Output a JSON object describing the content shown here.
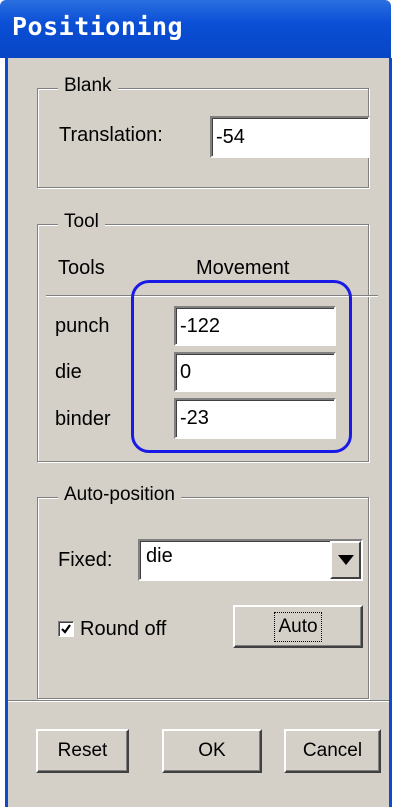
{
  "window": {
    "title": "Positioning"
  },
  "blank": {
    "group_label": "Blank",
    "translation_label": "Translation:",
    "translation_value": "-54"
  },
  "tool": {
    "group_label": "Tool",
    "col_tools": "Tools",
    "col_movement": "Movement",
    "rows": [
      {
        "name": "punch",
        "value": "-122"
      },
      {
        "name": "die",
        "value": "0"
      },
      {
        "name": "binder",
        "value": "-23"
      }
    ]
  },
  "auto_position": {
    "group_label": "Auto-position",
    "fixed_label": "Fixed:",
    "fixed_value": "die",
    "round_off_label": "Round off",
    "round_off_checked": true,
    "auto_button": "Auto"
  },
  "buttons": {
    "reset": "Reset",
    "ok": "OK",
    "cancel": "Cancel"
  },
  "colors": {
    "title_bar": "#0a4fd6",
    "dialog_bg": "#d4d0c8",
    "highlight": "#1a1ae6"
  },
  "icons": {
    "dropdown": "chevron-down-icon",
    "checkbox": "checkmark-icon"
  }
}
